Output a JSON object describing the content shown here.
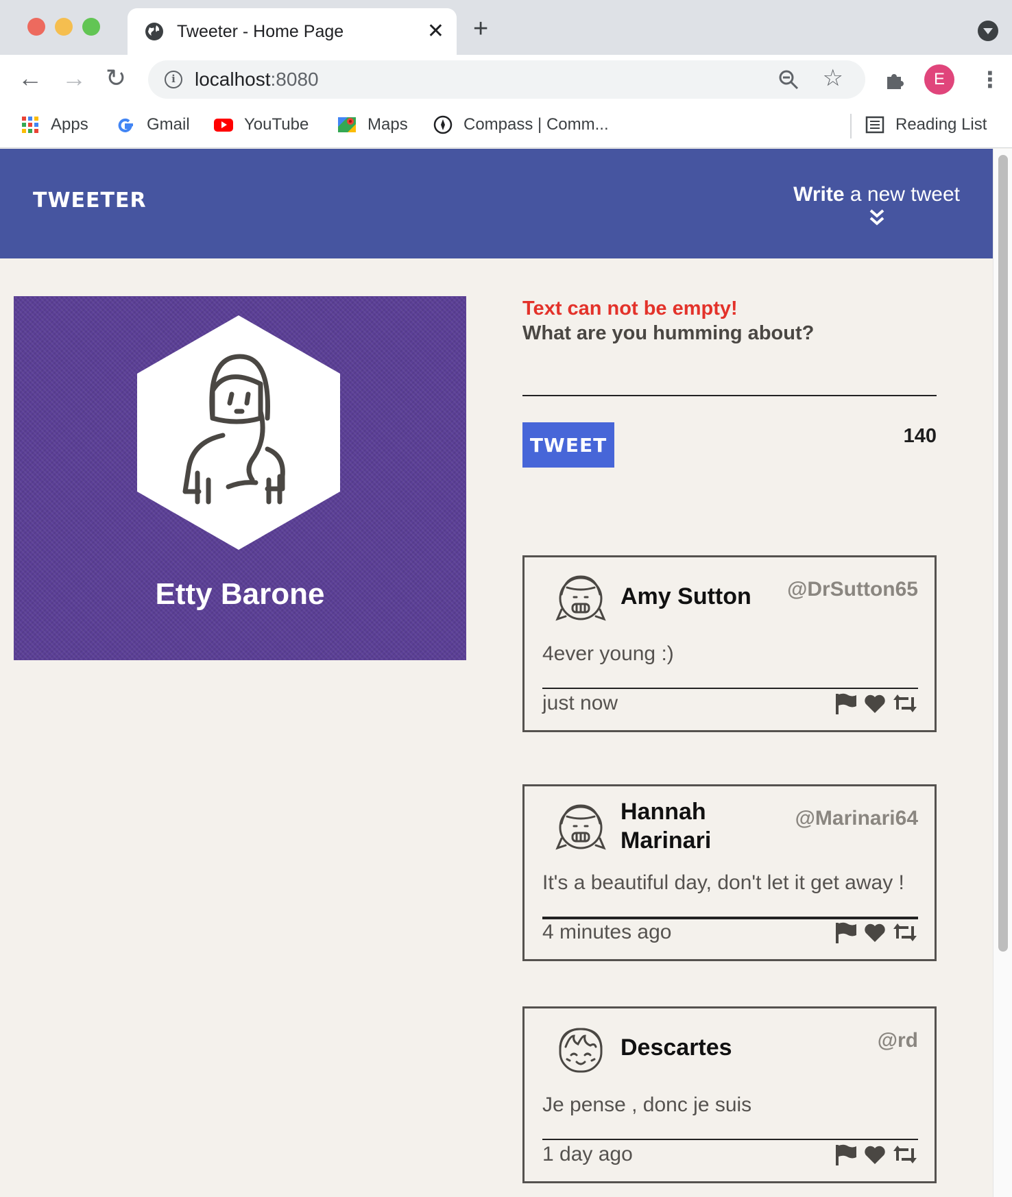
{
  "browser": {
    "tab_title": "Tweeter - Home Page",
    "url_host": "localhost",
    "url_port": ":8080",
    "profile_initial": "E",
    "bookmarks": [
      {
        "label": "Apps",
        "icon": "apps-grid-icon"
      },
      {
        "label": "Gmail",
        "icon": "google-icon"
      },
      {
        "label": "YouTube",
        "icon": "youtube-icon"
      },
      {
        "label": "Maps",
        "icon": "maps-icon"
      },
      {
        "label": "Compass | Comm...",
        "icon": "compass-icon"
      }
    ],
    "reading_list": "Reading List"
  },
  "nav": {
    "brand": "TWEETER",
    "write_strong": "Write",
    "write_rest": " a new tweet"
  },
  "profile": {
    "name": "Etty Barone",
    "background_color": "#5b3f96"
  },
  "compose": {
    "error": "Text can not be empty!",
    "label": "What are you humming about?",
    "input_value": "",
    "button_label": "TWEET",
    "counter": "140"
  },
  "tweets": [
    {
      "name": "Amy Sutton",
      "handle": "@DrSutton65",
      "text": "4ever young :)",
      "time": "just now"
    },
    {
      "name": "Hannah Marinari",
      "handle": "@Marinari64",
      "text": "It's a beautiful day, don't let it get away !",
      "time": "4 minutes ago"
    },
    {
      "name": "Descartes",
      "handle": "@rd",
      "text": "Je pense , donc je suis",
      "time": "1 day ago"
    }
  ],
  "colors": {
    "nav_bg": "#4655a0",
    "page_bg": "#f4f1ec",
    "error": "#e3322a",
    "tweet_button": "#4766d8"
  }
}
